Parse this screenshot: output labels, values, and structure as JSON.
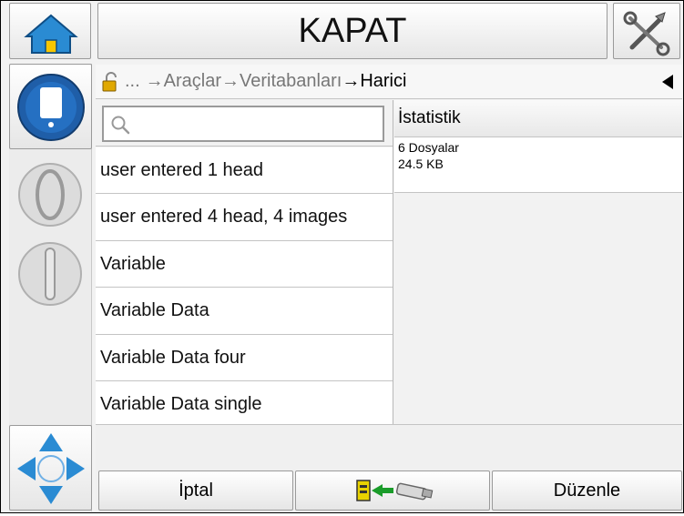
{
  "header": {
    "title": "KAPAT"
  },
  "breadcrumb": {
    "ellipsis": "...",
    "path1": "Araçlar",
    "path2": "Veritabanları",
    "path3": "Harici",
    "arrow": "→"
  },
  "search": {
    "placeholder": ""
  },
  "list": {
    "items": [
      "user entered 1 head",
      "user entered 4 head, 4 images",
      "Variable",
      "Variable Data",
      "Variable Data four",
      "Variable Data single"
    ]
  },
  "stats": {
    "header": "İstatistik",
    "files": "6 Dosyalar",
    "size": "24.5 KB"
  },
  "bottom": {
    "cancel_label": "İptal",
    "edit_label": "Düzenle"
  },
  "colors": {
    "accent_blue": "#1f5ea8",
    "home_blue": "#2a8bd3",
    "arrow_green": "#1a9c2a",
    "file_yellow": "#e8d200"
  }
}
